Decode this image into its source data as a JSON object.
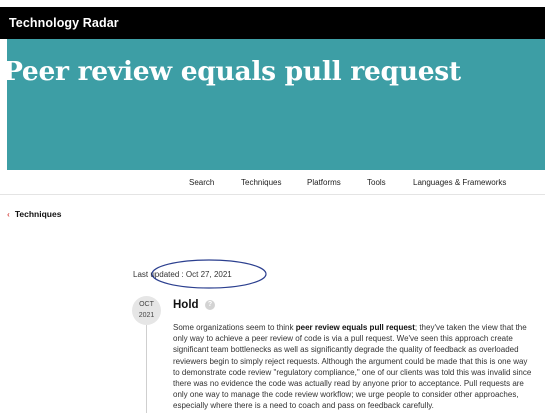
{
  "header": {
    "brand": "Technology Radar"
  },
  "hero": {
    "title": "Peer review equals pull request"
  },
  "nav": {
    "items": [
      "Search",
      "Techniques",
      "Platforms",
      "Tools",
      "Languages & Frameworks"
    ]
  },
  "breadcrumb": {
    "label": "Techniques"
  },
  "meta": {
    "last_updated": "Last updated : Oct 27, 2021"
  },
  "blip": {
    "date_month": "OCT",
    "date_year": "2021",
    "ring": "Hold",
    "text_lines": [
      {
        "before": "Some organizations seem to think ",
        "bold": "peer review equals pull request",
        "after": "; they've taken the view that the"
      },
      {
        "before": "only way to achieve a peer review of code is via a pull request. We've seen this approach create"
      },
      {
        "before": "significant team bottlenecks as well as significantly degrade the quality of feedback as overloaded"
      },
      {
        "before": "reviewers begin to simply reject requests. Although the argument could be made that this is one way"
      },
      {
        "before": "to demonstrate code review \"regulatory compliance,\" one of our clients was told this was invalid since"
      },
      {
        "before": "there was no evidence the code was actually read by anyone prior to acceptance. Pull requests are"
      },
      {
        "before": "only one way to manage the code review workflow; we urge people to consider other approaches,"
      },
      {
        "before": "especially where there is a need to coach and pass on feedback carefully."
      }
    ]
  },
  "colors": {
    "topbar": "#000000",
    "hero_bg": "#3d9ea5",
    "annotation": "#2b3f8f",
    "breadcrumb_chevron": "#d9534f"
  },
  "icons": {
    "help": "question-circle-icon",
    "back": "chevron-left-icon"
  }
}
